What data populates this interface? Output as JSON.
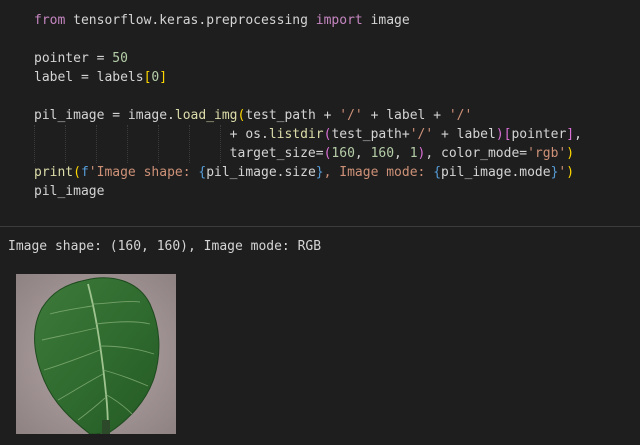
{
  "code_lines": [
    {
      "tokens": [
        {
          "t": "from",
          "c": "kw2"
        },
        {
          "t": " tensorflow.keras.preprocessing ",
          "c": "var"
        },
        {
          "t": "import",
          "c": "kw2"
        },
        {
          "t": " image",
          "c": "var"
        }
      ]
    },
    {
      "tokens": []
    },
    {
      "tokens": [
        {
          "t": "pointer = ",
          "c": "var"
        },
        {
          "t": "50",
          "c": "num"
        }
      ]
    },
    {
      "tokens": [
        {
          "t": "label = labels",
          "c": "var"
        },
        {
          "t": "[",
          "c": "brk1"
        },
        {
          "t": "0",
          "c": "num"
        },
        {
          "t": "]",
          "c": "brk1"
        }
      ]
    },
    {
      "tokens": []
    },
    {
      "tokens": [
        {
          "t": "pil_image = image.",
          "c": "var"
        },
        {
          "t": "load_img",
          "c": "fn"
        },
        {
          "t": "(",
          "c": "brk1"
        },
        {
          "t": "test_path + ",
          "c": "var"
        },
        {
          "t": "'/'",
          "c": "str"
        },
        {
          "t": " + label + ",
          "c": "var"
        },
        {
          "t": "'/'",
          "c": "str"
        }
      ]
    },
    {
      "tokens": [
        {
          "t": "                         + os.",
          "c": "var"
        },
        {
          "t": "listdir",
          "c": "fn"
        },
        {
          "t": "(",
          "c": "brk2"
        },
        {
          "t": "test_path+",
          "c": "var"
        },
        {
          "t": "'/'",
          "c": "str"
        },
        {
          "t": " + label",
          "c": "var"
        },
        {
          "t": ")",
          "c": "brk2"
        },
        {
          "t": "[",
          "c": "brk2"
        },
        {
          "t": "pointer",
          "c": "var"
        },
        {
          "t": "]",
          "c": "brk2"
        },
        {
          "t": ",",
          "c": "var"
        }
      ]
    },
    {
      "tokens": [
        {
          "t": "                         target_size=",
          "c": "var"
        },
        {
          "t": "(",
          "c": "brk2"
        },
        {
          "t": "160",
          "c": "num"
        },
        {
          "t": ", ",
          "c": "var"
        },
        {
          "t": "160",
          "c": "num"
        },
        {
          "t": ", ",
          "c": "var"
        },
        {
          "t": "1",
          "c": "num"
        },
        {
          "t": ")",
          "c": "brk2"
        },
        {
          "t": ", color_mode=",
          "c": "var"
        },
        {
          "t": "'rgb'",
          "c": "str"
        },
        {
          "t": ")",
          "c": "brk1"
        }
      ]
    },
    {
      "tokens": [
        {
          "t": "print",
          "c": "fn"
        },
        {
          "t": "(",
          "c": "brk1"
        },
        {
          "t": "f",
          "c": "kw"
        },
        {
          "t": "'Image shape: ",
          "c": "str"
        },
        {
          "t": "{",
          "c": "kw"
        },
        {
          "t": "pil_image.size",
          "c": "var"
        },
        {
          "t": "}",
          "c": "kw"
        },
        {
          "t": ", Image mode: ",
          "c": "str"
        },
        {
          "t": "{",
          "c": "kw"
        },
        {
          "t": "pil_image.mode",
          "c": "var"
        },
        {
          "t": "}",
          "c": "kw"
        },
        {
          "t": "'",
          "c": "str"
        },
        {
          "t": ")",
          "c": "brk1"
        }
      ]
    },
    {
      "tokens": [
        {
          "t": "pil_image",
          "c": "var"
        }
      ]
    }
  ],
  "output": {
    "text": "Image shape: (160, 160), Image mode: RGB",
    "image_alt": "leaf-image"
  },
  "colors": {
    "background": "#1e1e1e",
    "keyword": "#c586c0",
    "string": "#ce9178",
    "number": "#b5cea8",
    "function": "#dcdcaa"
  }
}
